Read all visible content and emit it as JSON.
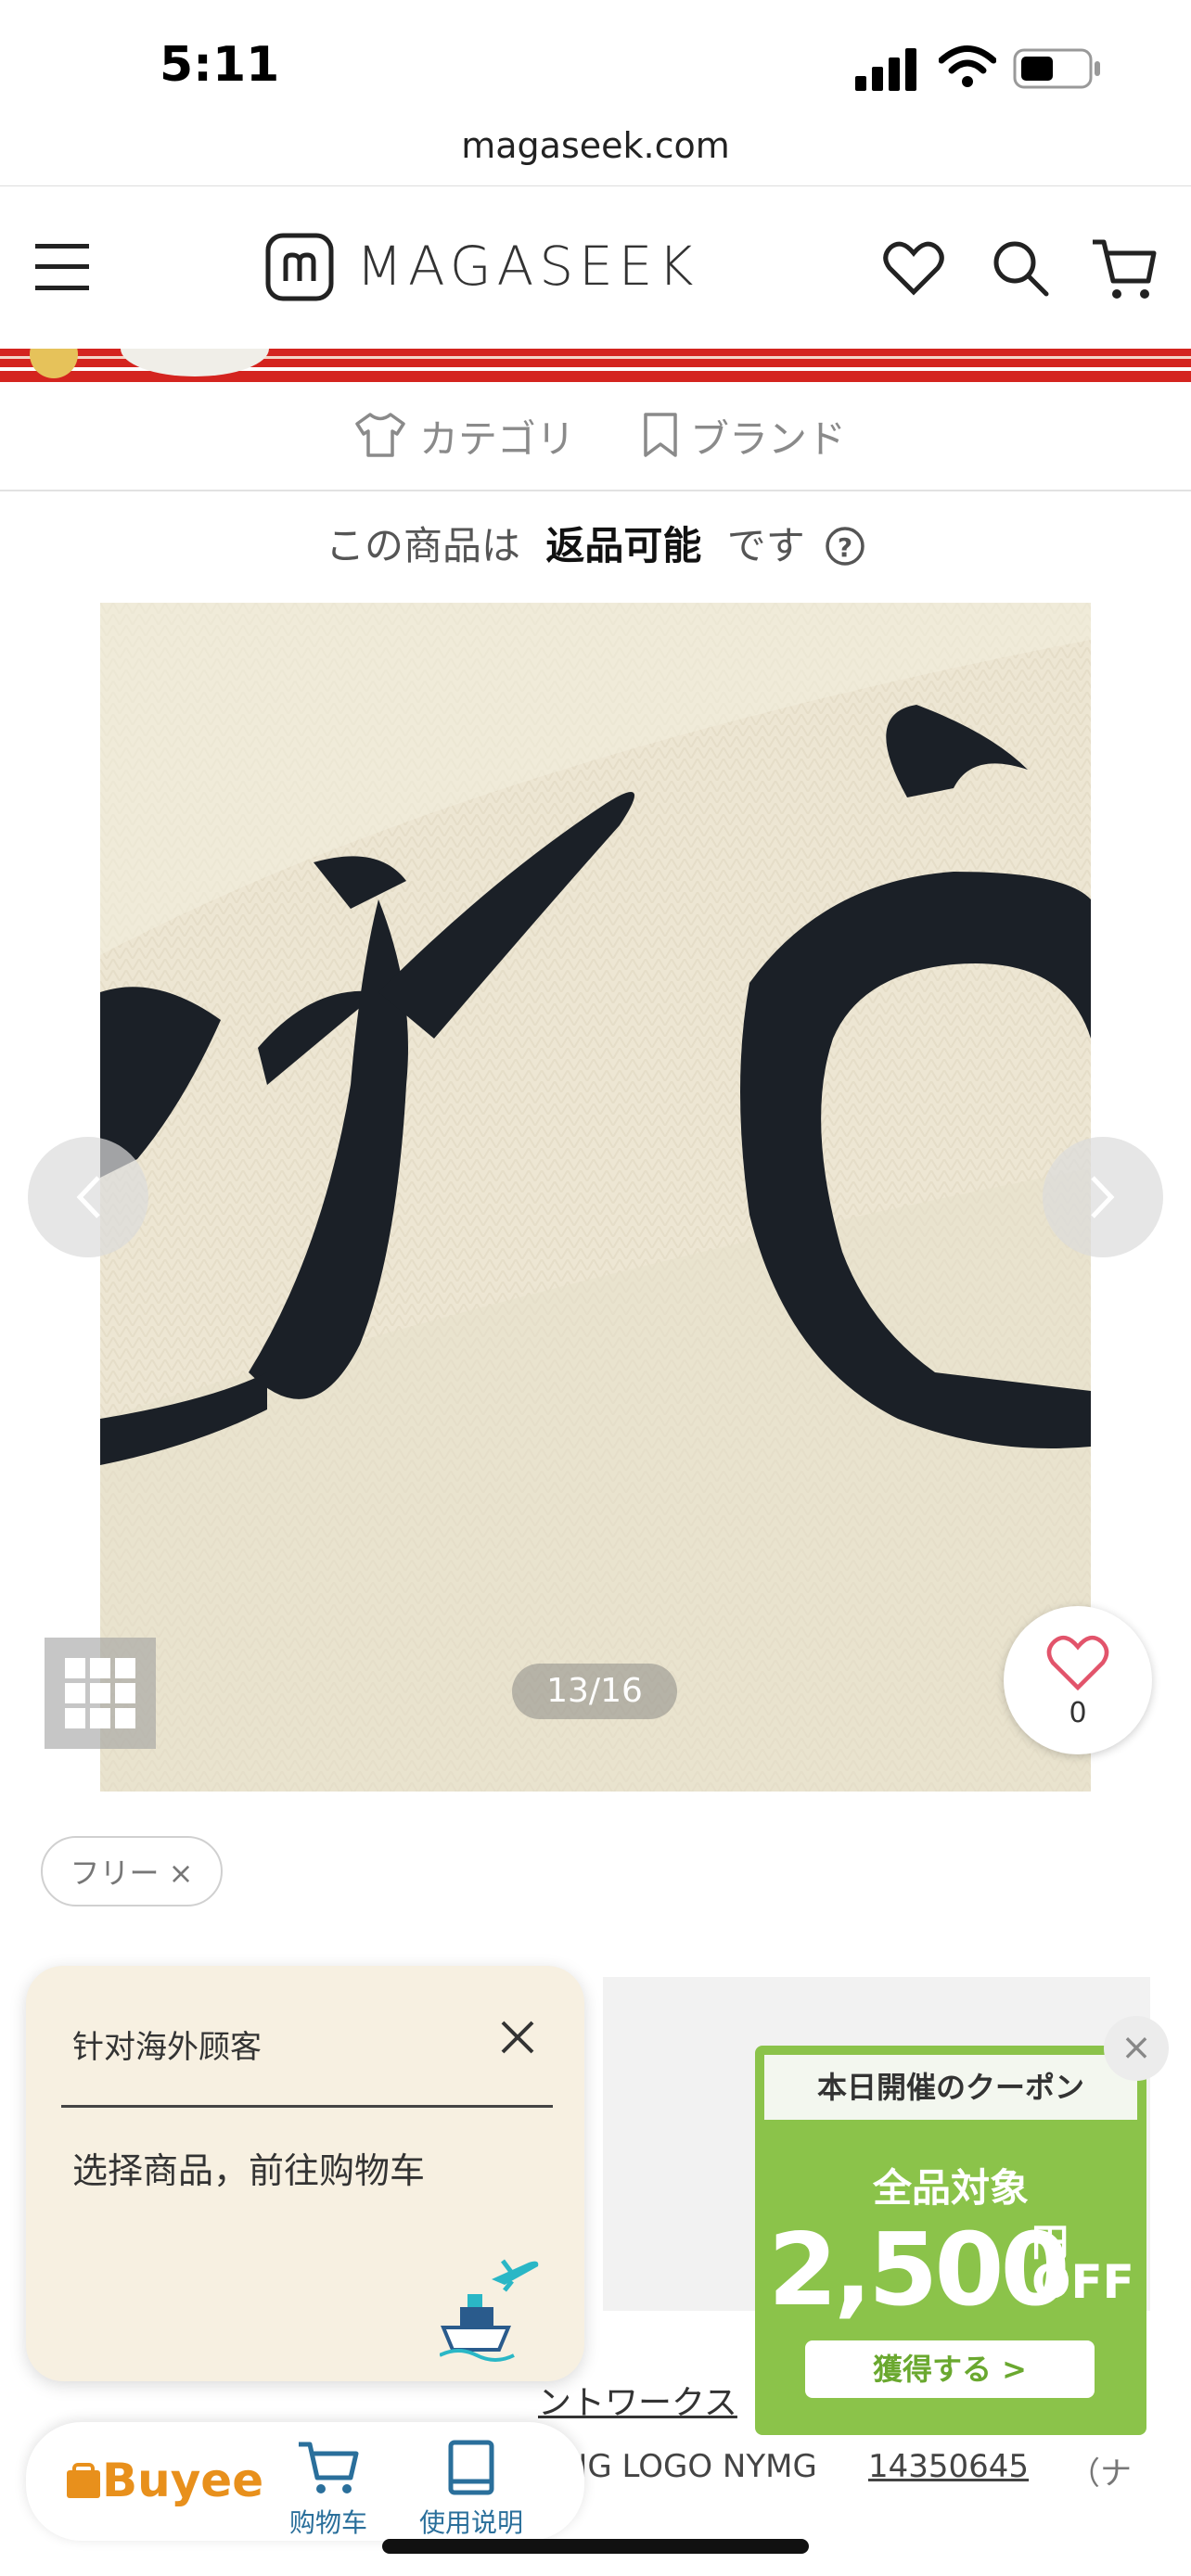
{
  "status_bar": {
    "time": "5:11"
  },
  "browser": {
    "url": "magaseek.com"
  },
  "header": {
    "brand": "MAGASEEK"
  },
  "nav": {
    "category": "カテゴリ",
    "brand": "ブランド"
  },
  "return_notice": {
    "prefix": "この商品は",
    "emphasis": "返品可能",
    "suffix": "です"
  },
  "gallery": {
    "counter": "13/16"
  },
  "favorite": {
    "count": "0"
  },
  "size_chip": "フリー ×",
  "popup": {
    "title": "针对海外顾客",
    "message": "选择商品，前往购物车"
  },
  "coupon": {
    "header": "本日開催のクーポン",
    "subtitle": "全品対象",
    "amount": "2,500",
    "unit": "円",
    "off": "OFF",
    "button": "獲得する >"
  },
  "buyee": {
    "logo": "Buyee",
    "cart": "购物车",
    "guide": "使用说明"
  },
  "product": {
    "brand": "ントワークス",
    "name": "BIG LOGO NYMG",
    "code": "14350645",
    "tail": "（ナ"
  }
}
